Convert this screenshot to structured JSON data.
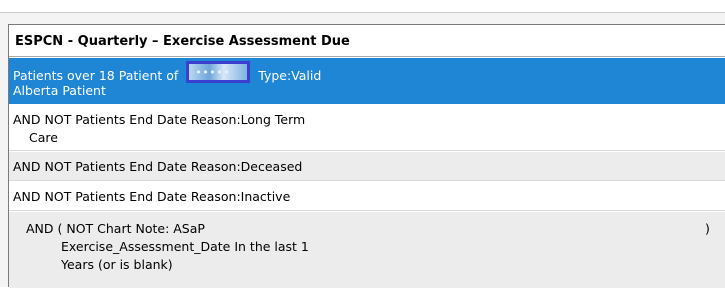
{
  "header": {
    "title": "ESPCN - Quarterly – Exercise Assessment Due"
  },
  "rows": [
    {
      "line1_before": "Patients over 18 Patient of",
      "redacted_text": "•••••",
      "line1_after": "Type:Valid",
      "line2": "Alberta Patient"
    },
    {
      "line1": "AND NOT Patients End Date Reason:Long Term",
      "line2": "Care"
    },
    {
      "line1": "AND NOT Patients End Date Reason:Deceased"
    },
    {
      "line1": "AND NOT Patients End Date Reason:Inactive"
    },
    {
      "line1": "AND ( NOT Chart Note: ASaP",
      "line2": "Exercise_Assessment_Date In the last 1",
      "line3": "Years  (or is blank)",
      "close_paren": ")"
    }
  ],
  "colors": {
    "selected_row": "#1f86d6",
    "redaction_box": "#3b3fd1",
    "alt_row": "#ececec"
  }
}
